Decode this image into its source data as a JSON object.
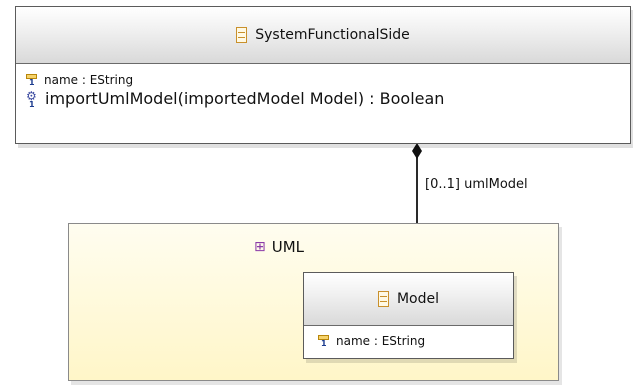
{
  "diagram": {
    "system_class": {
      "name": "SystemFunctionalSide",
      "attribute": "name : EString",
      "operation": "importUmlModel(importedModel Model) : Boolean"
    },
    "association": {
      "role": "[0..1] umlModel",
      "kind": "composition"
    },
    "package": {
      "name": "UML",
      "color": "#fff6c8"
    },
    "model_class": {
      "name": "Model",
      "attribute": "name : EString"
    },
    "icons": {
      "class": "class-icon",
      "attribute": "attribute-icon",
      "operation": "operation-gear-icon",
      "package": "package-icon"
    }
  }
}
